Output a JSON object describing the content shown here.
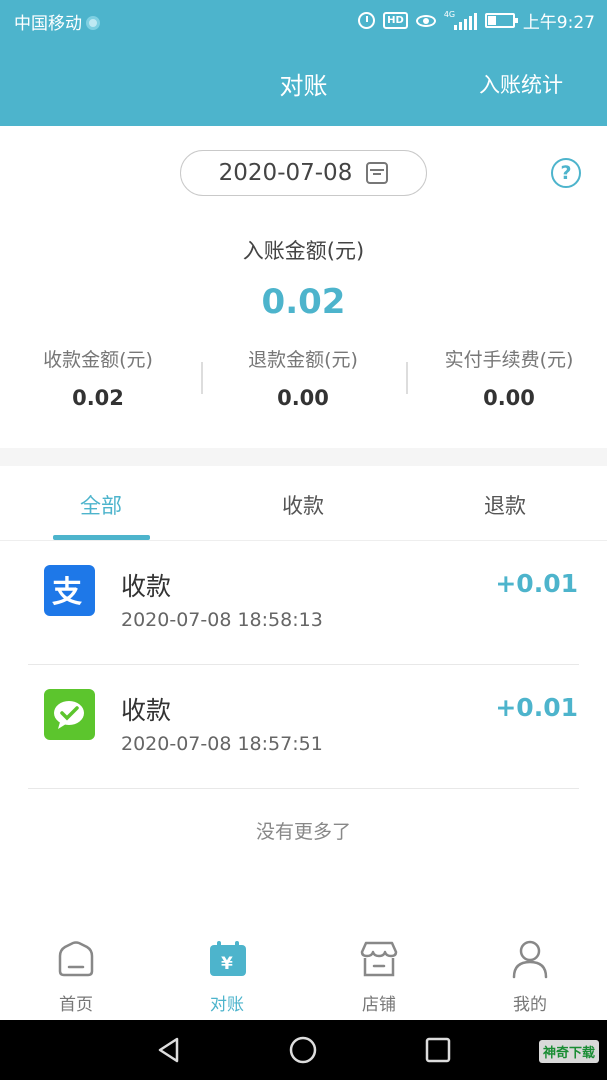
{
  "status_bar": {
    "carrier": "中国移动",
    "network": "4G",
    "hd": "HD",
    "time": "上午9:27"
  },
  "header": {
    "title": "对账",
    "stats_link": "入账统计"
  },
  "summary": {
    "date": "2020-07-08",
    "income_label": "入账金额(元)",
    "income_value": "0.02",
    "stats": [
      {
        "label": "收款金额(元)",
        "value": "0.02"
      },
      {
        "label": "退款金额(元)",
        "value": "0.00"
      },
      {
        "label": "实付手续费(元)",
        "value": "0.00"
      }
    ],
    "help_glyph": "?"
  },
  "tabs": [
    {
      "label": "全部",
      "active": true
    },
    {
      "label": "收款",
      "active": false
    },
    {
      "label": "退款",
      "active": false
    }
  ],
  "transactions": [
    {
      "icon": "alipay-icon",
      "title": "收款",
      "time": "2020-07-08 18:58:13",
      "amount": "+0.01"
    },
    {
      "icon": "wechat-pay-icon",
      "title": "收款",
      "time": "2020-07-08 18:57:51",
      "amount": "+0.01"
    }
  ],
  "no_more": "没有更多了",
  "bottom_nav": [
    {
      "label": "首页",
      "icon": "home-icon",
      "active": false
    },
    {
      "label": "对账",
      "icon": "reconcile-icon",
      "active": true
    },
    {
      "label": "店铺",
      "icon": "store-icon",
      "active": false
    },
    {
      "label": "我的",
      "icon": "profile-icon",
      "active": false
    }
  ],
  "watermark": "神奇下载",
  "colors": {
    "accent": "#4db4cc",
    "alipay": "#1e78e8",
    "wechat": "#5cc52d"
  }
}
